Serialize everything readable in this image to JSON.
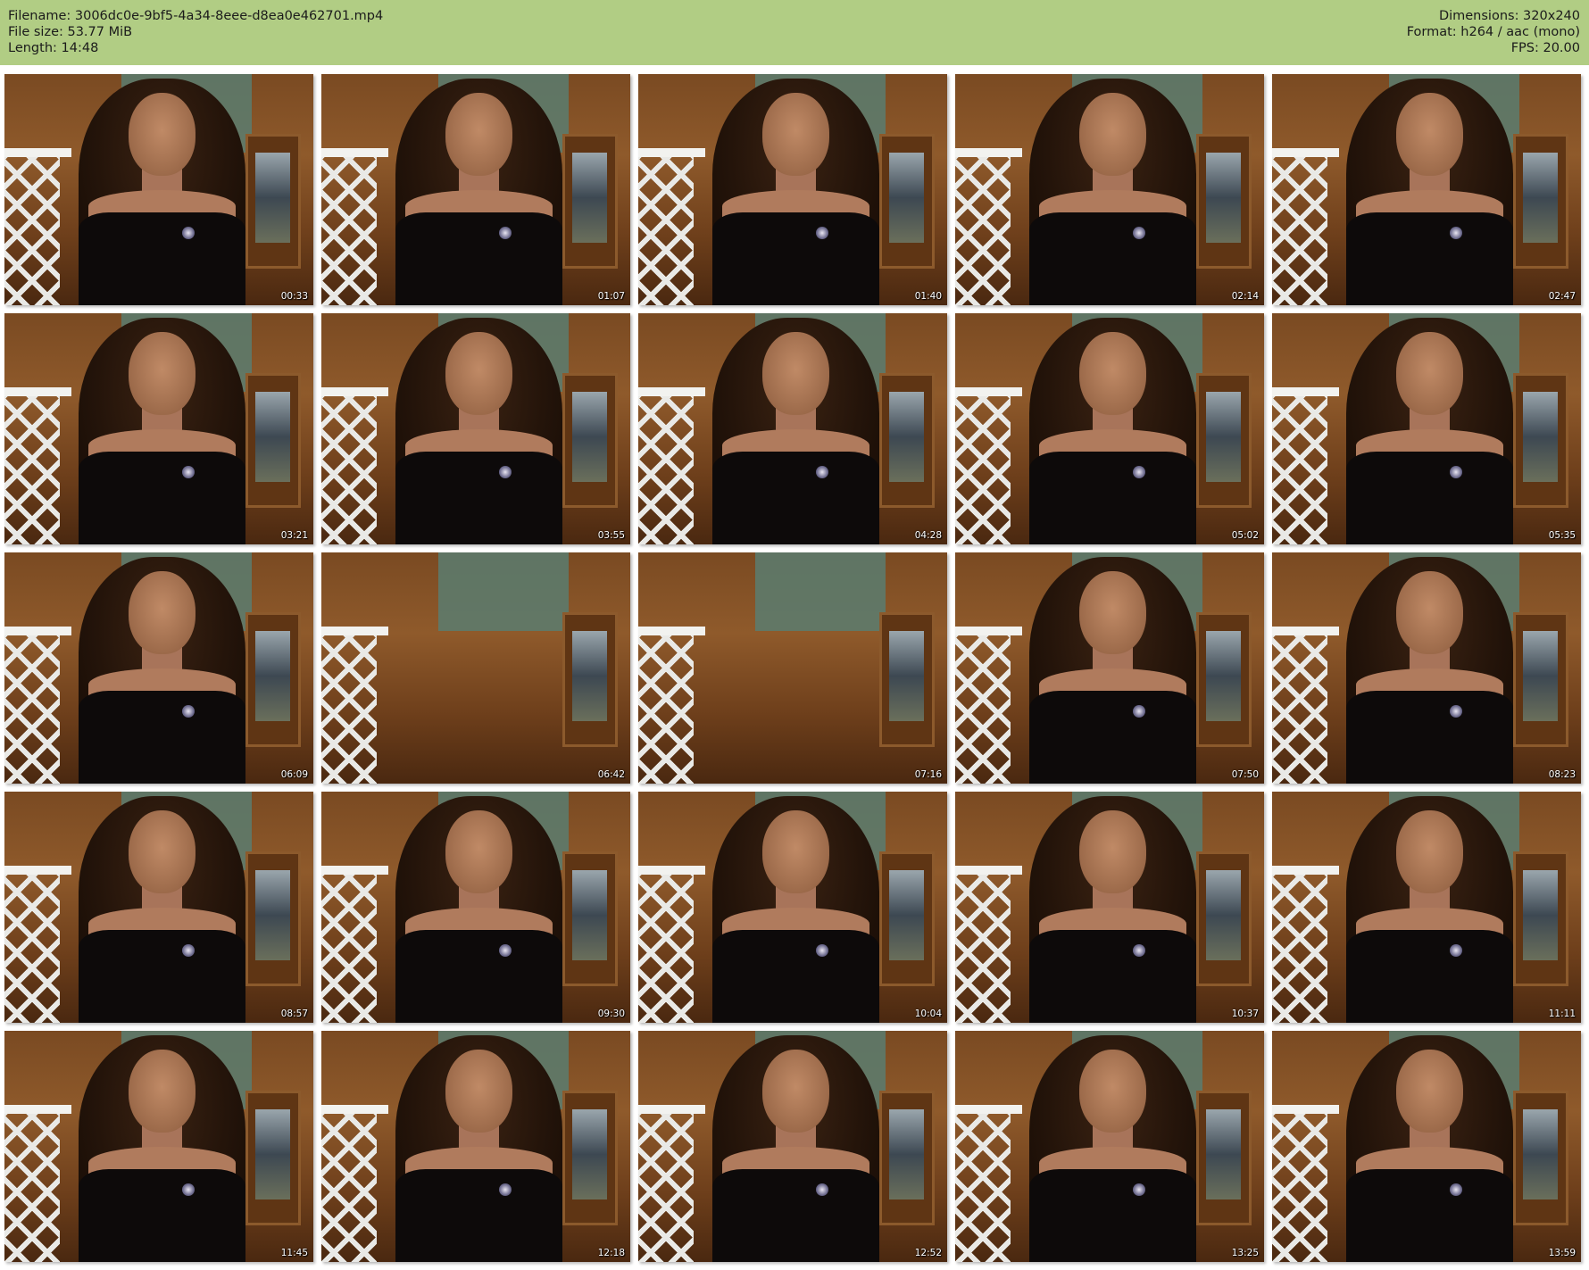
{
  "header": {
    "filename": "Filename: 3006dc0e-9bf5-4a34-8eee-d8ea0e462701.mp4",
    "filesize": "File size: 53.77 MiB",
    "length": "Length: 14:48",
    "dimensions": "Dimensions: 320x240",
    "format": "Format: h264 / aac (mono)",
    "fps": "FPS: 20.00"
  },
  "colors": {
    "header_background": "#b1cd84",
    "sheet_background": "#ffffff"
  },
  "thumbnails": [
    {
      "time": "00:33"
    },
    {
      "time": "01:07"
    },
    {
      "time": "01:40"
    },
    {
      "time": "02:14"
    },
    {
      "time": "02:47"
    },
    {
      "time": "03:21"
    },
    {
      "time": "03:55"
    },
    {
      "time": "04:28"
    },
    {
      "time": "05:02"
    },
    {
      "time": "05:35"
    },
    {
      "time": "06:09"
    },
    {
      "time": "06:42"
    },
    {
      "time": "07:16"
    },
    {
      "time": "07:50"
    },
    {
      "time": "08:23"
    },
    {
      "time": "08:57"
    },
    {
      "time": "09:30"
    },
    {
      "time": "10:04"
    },
    {
      "time": "10:37"
    },
    {
      "time": "11:11"
    },
    {
      "time": "11:45"
    },
    {
      "time": "12:18"
    },
    {
      "time": "12:52"
    },
    {
      "time": "13:25"
    },
    {
      "time": "13:59"
    }
  ]
}
